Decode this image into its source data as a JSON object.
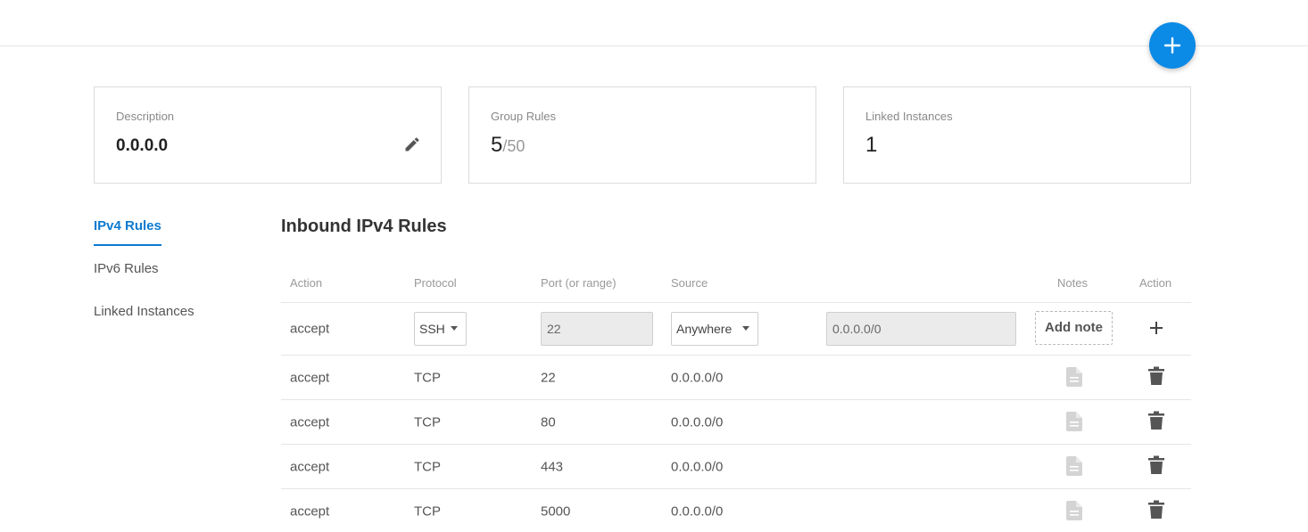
{
  "fab": {
    "icon": "plus-icon"
  },
  "cards": {
    "description": {
      "label": "Description",
      "value": "0.0.0.0",
      "icon": "pencil-icon"
    },
    "group_rules": {
      "label": "Group Rules",
      "value": "5",
      "max": "/50"
    },
    "linked_instances": {
      "label": "Linked Instances",
      "value": "1"
    }
  },
  "sidenav": {
    "items": [
      {
        "label": "IPv4 Rules",
        "active": true
      },
      {
        "label": "IPv6 Rules",
        "active": false
      },
      {
        "label": "Linked Instances",
        "active": false
      }
    ]
  },
  "section_title": "Inbound IPv4 Rules",
  "table": {
    "headers": {
      "action": "Action",
      "protocol": "Protocol",
      "port": "Port (or range)",
      "source": "Source",
      "notes": "Notes",
      "action2": "Action"
    },
    "new_rule": {
      "action": "accept",
      "protocol": "SSH",
      "port": "22",
      "source": "Anywhere",
      "cidr": "0.0.0.0/0",
      "add_note": "Add note"
    },
    "rows": [
      {
        "action": "accept",
        "protocol": "TCP",
        "port": "22",
        "source": "0.0.0.0/0"
      },
      {
        "action": "accept",
        "protocol": "TCP",
        "port": "80",
        "source": "0.0.0.0/0"
      },
      {
        "action": "accept",
        "protocol": "TCP",
        "port": "443",
        "source": "0.0.0.0/0"
      },
      {
        "action": "accept",
        "protocol": "TCP",
        "port": "5000",
        "source": "0.0.0.0/0"
      }
    ]
  },
  "colors": {
    "accent": "#0b8ae6",
    "active_nav": "#0b7ad1",
    "muted": "#999999"
  }
}
